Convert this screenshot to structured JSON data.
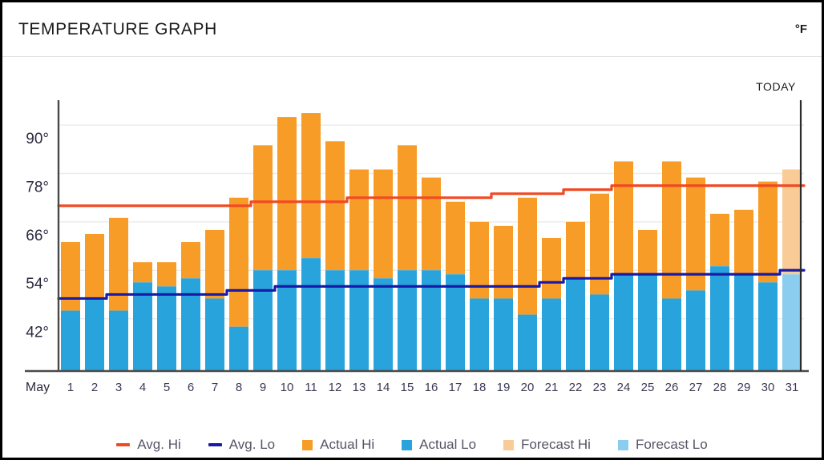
{
  "header": {
    "title": "TEMPERATURE GRAPH",
    "unit": "°F"
  },
  "today_marker": {
    "label": "TODAY",
    "day": 31
  },
  "month_label": "May",
  "axis": {
    "y_ticks": [
      "42°",
      "54°",
      "66°",
      "78°",
      "90°"
    ],
    "y_values": [
      42,
      54,
      66,
      78,
      90
    ]
  },
  "legend": [
    {
      "label": "Avg. Hi",
      "type": "line",
      "color": "#F04A23"
    },
    {
      "label": "Avg. Lo",
      "type": "line",
      "color": "#1A1AA8"
    },
    {
      "label": "Actual Hi",
      "type": "box",
      "color": "#F89C28"
    },
    {
      "label": "Actual Lo",
      "type": "box",
      "color": "#29A3DC"
    },
    {
      "label": "Forecast Hi",
      "type": "box",
      "color": "#F9CB96"
    },
    {
      "label": "Forecast Lo",
      "type": "box",
      "color": "#8ACDEF"
    }
  ],
  "colors": {
    "actual_hi": "#F89C28",
    "actual_lo": "#29A3DC",
    "forecast_hi": "#F9CB96",
    "forecast_lo": "#8ACDEF",
    "avg_hi_line": "#F04A23",
    "avg_lo_line": "#1A1AA8",
    "axis": "#4a4a4a",
    "grid": "#ececed",
    "today_line": "#2b2b2b",
    "border": "#000000"
  },
  "chart_data": {
    "type": "bar",
    "title": "TEMPERATURE GRAPH",
    "subtitle": "",
    "xlabel": "May",
    "ylabel": "°F",
    "ylim": [
      29,
      95
    ],
    "grid": true,
    "legend_position": "bottom",
    "yticks": [
      42,
      54,
      66,
      78,
      90
    ],
    "categories": [
      "1",
      "2",
      "3",
      "4",
      "5",
      "6",
      "7",
      "8",
      "9",
      "10",
      "11",
      "12",
      "13",
      "14",
      "15",
      "16",
      "17",
      "18",
      "19",
      "20",
      "21",
      "22",
      "23",
      "24",
      "25",
      "26",
      "27",
      "28",
      "29",
      "30",
      "31"
    ],
    "series": [
      {
        "name": "Actual Hi",
        "type": "bar-top",
        "color": "#F89C28",
        "values": [
          61,
          63,
          67,
          56,
          56,
          61,
          64,
          72,
          85,
          92,
          93,
          86,
          79,
          79,
          85,
          77,
          71,
          66,
          65,
          72,
          62,
          66,
          73,
          81,
          64,
          81,
          77,
          68,
          69,
          76,
          null
        ]
      },
      {
        "name": "Actual Lo",
        "type": "bar-bottom",
        "color": "#29A3DC",
        "values": [
          44,
          47,
          44,
          51,
          50,
          52,
          47,
          40,
          54,
          54,
          57,
          54,
          54,
          52,
          54,
          54,
          53,
          47,
          47,
          43,
          47,
          52,
          48,
          53,
          53,
          47,
          49,
          55,
          53,
          51,
          null
        ]
      },
      {
        "name": "Forecast Hi",
        "type": "bar-top",
        "color": "#F9CB96",
        "values": [
          null,
          null,
          null,
          null,
          null,
          null,
          null,
          null,
          null,
          null,
          null,
          null,
          null,
          null,
          null,
          null,
          null,
          null,
          null,
          null,
          null,
          null,
          null,
          null,
          null,
          null,
          null,
          null,
          null,
          null,
          79
        ]
      },
      {
        "name": "Forecast Lo",
        "type": "bar-bottom",
        "color": "#8ACDEF",
        "values": [
          null,
          null,
          null,
          null,
          null,
          null,
          null,
          null,
          null,
          null,
          null,
          null,
          null,
          null,
          null,
          null,
          null,
          null,
          null,
          null,
          null,
          null,
          null,
          null,
          null,
          null,
          null,
          null,
          null,
          null,
          53
        ]
      },
      {
        "name": "Avg. Hi",
        "type": "line",
        "color": "#F04A23",
        "values": [
          70,
          70,
          70,
          70,
          70,
          70,
          70,
          70,
          71,
          71,
          71,
          71,
          72,
          72,
          72,
          72,
          72,
          72,
          73,
          73,
          73,
          74,
          74,
          75,
          75,
          75,
          75,
          75,
          75,
          75,
          75
        ]
      },
      {
        "name": "Avg. Lo",
        "type": "line",
        "color": "#1A1AA8",
        "values": [
          47,
          47,
          48,
          48,
          48,
          48,
          48,
          49,
          49,
          50,
          50,
          50,
          50,
          50,
          50,
          50,
          50,
          50,
          50,
          50,
          51,
          52,
          52,
          53,
          53,
          53,
          53,
          53,
          53,
          53,
          54
        ]
      }
    ]
  }
}
